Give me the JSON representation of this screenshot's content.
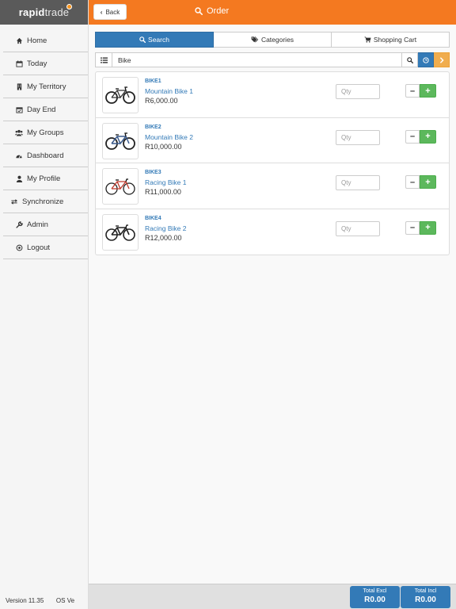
{
  "app": {
    "logo_text": "rapid",
    "logo_text_b": "trade"
  },
  "header": {
    "back_label": "Back",
    "title": "Order"
  },
  "sidebar": {
    "items": [
      {
        "label": "Home",
        "icon": "home-icon"
      },
      {
        "label": "Today",
        "icon": "calendar-icon"
      },
      {
        "label": "My Territory",
        "icon": "building-icon"
      },
      {
        "label": "Day End",
        "icon": "calendar-check-icon"
      },
      {
        "label": "My Groups",
        "icon": "users-icon"
      },
      {
        "label": "Dashboard",
        "icon": "dashboard-icon"
      },
      {
        "label": "My Profile",
        "icon": "user-icon"
      },
      {
        "label": "Synchronize",
        "icon": "exchange-icon"
      },
      {
        "label": "Admin",
        "icon": "wrench-icon"
      },
      {
        "label": "Logout",
        "icon": "power-icon"
      }
    ],
    "version": "Version 11.35",
    "os": "OS Ve"
  },
  "tabs": [
    {
      "label": "Search",
      "icon": "search-icon",
      "active": true
    },
    {
      "label": "Categories",
      "icon": "tags-icon",
      "active": false
    },
    {
      "label": "Shopping Cart",
      "icon": "cart-icon",
      "active": false
    }
  ],
  "search": {
    "value": "Bike"
  },
  "products": [
    {
      "code": "BIKE1",
      "description": "Mountain Bike 1",
      "price": "R6,000.00",
      "qty_placeholder": "Qty"
    },
    {
      "code": "BIKE2",
      "description": "Mountain Bike 2",
      "price": "R10,000.00",
      "qty_placeholder": "Qty"
    },
    {
      "code": "BIKE3",
      "description": "Racing Bike 1",
      "price": "R11,000.00",
      "qty_placeholder": "Qty"
    },
    {
      "code": "BIKE4",
      "description": "Racing Bike 2",
      "price": "R12,000.00",
      "qty_placeholder": "Qty"
    }
  ],
  "totals": {
    "excl_label": "Total Excl",
    "excl_value": "R0.00",
    "incl_label": "Total Incl",
    "incl_value": "R0.00"
  },
  "colors": {
    "header": "#f47920",
    "primary": "#337ab7",
    "success": "#5cb85c",
    "warning": "#f0ad4e"
  }
}
